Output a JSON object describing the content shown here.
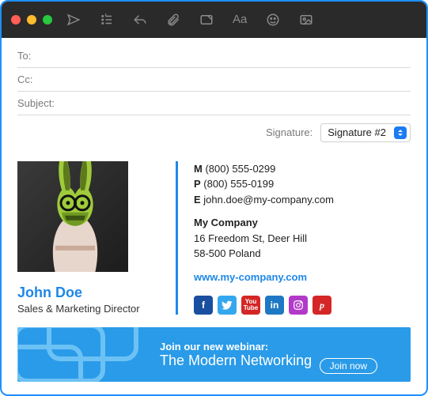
{
  "fields": {
    "to_label": "To:",
    "cc_label": "Cc:",
    "subject_label": "Subject:",
    "to_value": "",
    "cc_value": "",
    "subject_value": ""
  },
  "signature_picker": {
    "label": "Signature:",
    "selected": "Signature #2"
  },
  "signature": {
    "name": "John Doe",
    "title": "Sales & Marketing Director",
    "phone_mobile_label": "M",
    "phone_mobile": "(800) 555-0299",
    "phone_primary_label": "P",
    "phone_primary": "(800) 555-0199",
    "email_label": "E",
    "email": "john.doe@my-company.com",
    "company": "My Company",
    "address1": "16 Freedom St, Deer Hill",
    "address2": "58-500 Poland",
    "website": "www.my-company.com",
    "socials": {
      "facebook": "f",
      "twitter": "",
      "youtube": "You Tube",
      "linkedin": "in",
      "instagram": "",
      "pinterest": "p"
    }
  },
  "banner": {
    "line1": "Join our new webinar:",
    "line2": "The Modern Networking",
    "cta": "Join now"
  }
}
